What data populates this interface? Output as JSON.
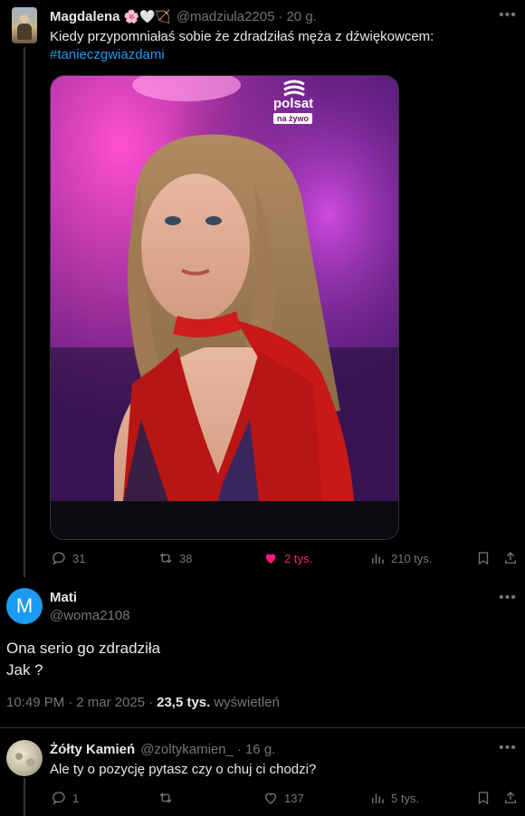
{
  "tweet1": {
    "author_name": "Magdalena",
    "emoji": "🌸🤍🏹",
    "handle": "@madziula2205",
    "separator": "·",
    "time": "20 g.",
    "text": "Kiedy przypomniałaś sobie że zdradziłaś męża z dźwiękowcem:",
    "hashtag": "#tanieczgwiazdami",
    "media_overlay": {
      "brand": "polsat",
      "live": "na żywo"
    },
    "actions": {
      "replies": "31",
      "retweets": "38",
      "likes": "2 tys.",
      "views": "210 tys."
    },
    "colors": {
      "liked": "#f91880"
    }
  },
  "tweet2": {
    "author_name": "Mati",
    "avatar_letter": "M",
    "handle": "@woma2108",
    "text_line1": "Ona serio go zdradziła",
    "text_line2": "Jak ?",
    "time": "10:49 PM",
    "separator": "·",
    "date": "2 mar 2025",
    "views_count": "23,5 tys.",
    "views_label": "wyświetleń",
    "colors": {
      "avatar_bg": "#1d9bf0"
    }
  },
  "tweet3": {
    "author_name": "Żółty Kamień",
    "handle": "@zoltykamien_",
    "separator": "·",
    "time": "16 g.",
    "text": "Ale ty o pozycję pytasz czy o chuj ci chodzi?",
    "actions": {
      "replies": "1",
      "retweets": "",
      "likes": "137",
      "views": "5 tys."
    }
  }
}
